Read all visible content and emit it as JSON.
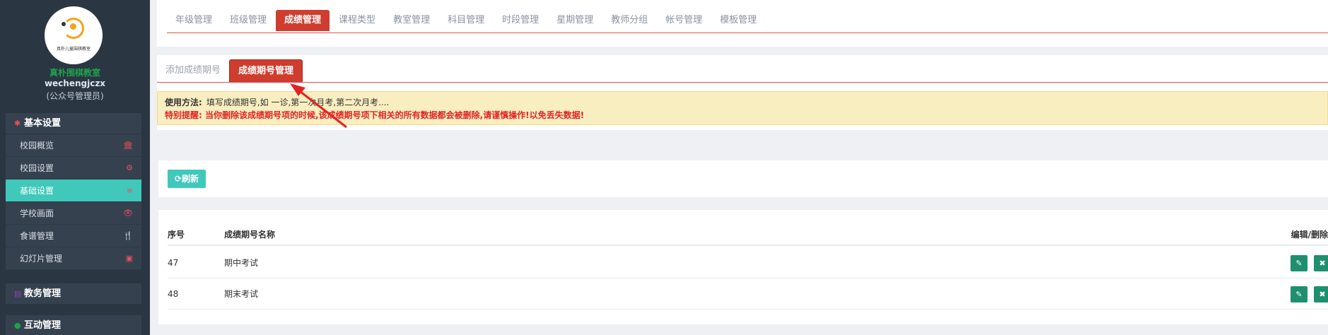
{
  "sidebar": {
    "logo_text": "真朴儿童围棋教室",
    "school_name": "真朴围棋教室",
    "account": "wechengjczx",
    "role": "(公众号管理员)",
    "sections": [
      {
        "title": "基本设置",
        "icon": "gear-icon",
        "items": [
          {
            "label": "校园概览",
            "icon": "bank-icon",
            "glyph": "🏛"
          },
          {
            "label": "校园设置",
            "icon": "gear-icon",
            "glyph": "⚙"
          },
          {
            "label": "基础设置",
            "icon": "list-icon",
            "glyph": "≡",
            "active": true
          },
          {
            "label": "学校画面",
            "icon": "eye-icon",
            "glyph": "👁"
          },
          {
            "label": "食谱管理",
            "icon": "cutlery-icon",
            "glyph": "🍴"
          },
          {
            "label": "幻灯片管理",
            "icon": "image-icon",
            "glyph": "▣"
          }
        ]
      },
      {
        "title": "教务管理",
        "icon": "database-icon"
      },
      {
        "title": "互动管理",
        "icon": "chat-icon"
      }
    ]
  },
  "top_tabs": [
    "年级管理",
    "班级管理",
    "成绩管理",
    "课程类型",
    "教室管理",
    "科目管理",
    "时段管理",
    "星期管理",
    "教师分组",
    "帐号管理",
    "模板管理"
  ],
  "top_active": 2,
  "sub_tabs": [
    "添加成绩期号",
    "成绩期号管理"
  ],
  "sub_active": 1,
  "notice": {
    "label": "使用方法:",
    "usage": "填写成绩期号,如 一诊,第一次月考,第二次月考....",
    "warning": "特别提醒: 当你删除该成绩期号项的时候,该成绩期号项下相关的所有数据都会被删除,请谨慎操作!以免丢失数据!"
  },
  "refresh_label": "⟳刷新",
  "table": {
    "headers": {
      "id": "序号",
      "name": "成绩期号名称",
      "actions": "编辑/删除"
    },
    "rows": [
      {
        "id": "47",
        "name": "期中考试"
      },
      {
        "id": "48",
        "name": "期末考试"
      }
    ],
    "edit_glyph": "✎",
    "delete_glyph": "✖"
  },
  "colors": {
    "sidebar_bg": "#2b3643",
    "active_teal": "#40c8bb",
    "tab_red": "#cf3d2f",
    "warning_red": "#e02424",
    "action_green": "#1e8f6f"
  }
}
